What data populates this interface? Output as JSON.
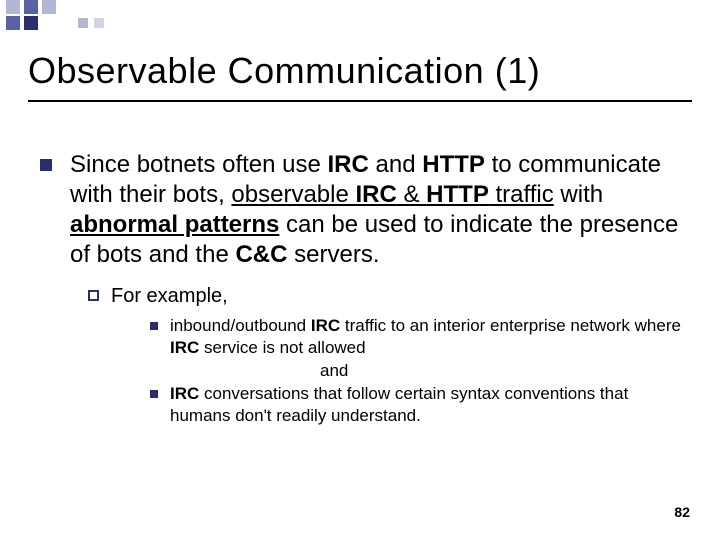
{
  "title": "Observable Communication (1)",
  "bullet1_html": "Since botnets often use <b>IRC</b> and <b>HTTP</b> to communicate with their bots, <span class='u'>observable <b>IRC</b> &amp; <b>HTTP</b> traffic</span> with <span class='u'><b>abnormal patterns</b></span> can be used to indicate the presence of bots and the <b>C&amp;C</b> servers.",
  "bullet2": "For example,",
  "bullet3a_html": "inbound/outbound <b>IRC</b> traffic to an interior enterprise network where <b>IRC</b> service is not allowed",
  "and": "and",
  "bullet3b_html": "<b>IRC</b> conversations that follow certain syntax conventions that humans don't readily understand.",
  "page_number": "82"
}
